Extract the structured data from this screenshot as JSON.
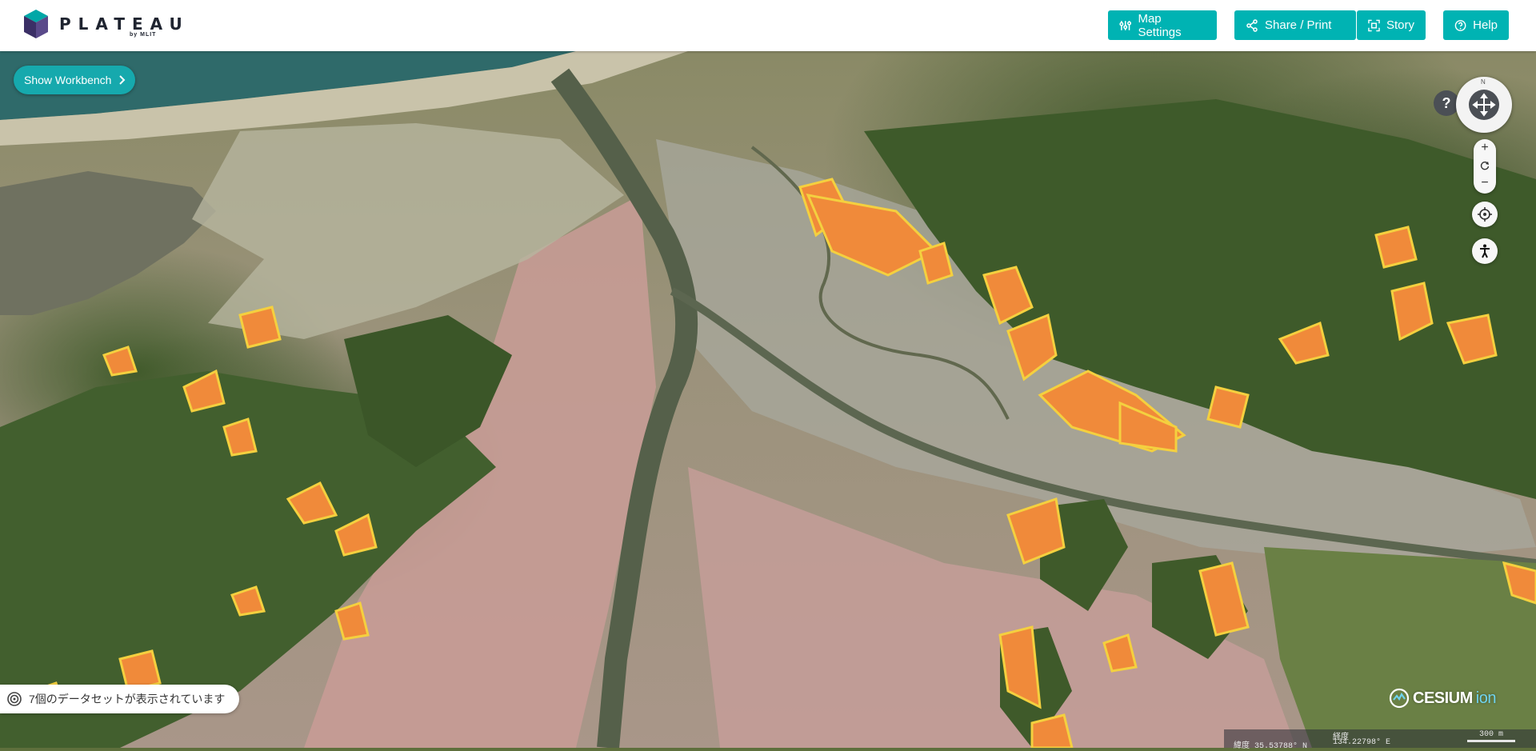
{
  "app": {
    "brand": "PLATEAU",
    "brand_sub": "by MLIT"
  },
  "toolbar": {
    "map_settings": "Map Settings",
    "share_print": "Share / Print",
    "story": "Story",
    "help": "Help"
  },
  "workbench": {
    "label": "Show Workbench"
  },
  "navigation": {
    "north": "N",
    "help": "?",
    "zoom_in": "+",
    "zoom_out": "−"
  },
  "status": {
    "datasets": "7個のデータセットが表示されています"
  },
  "attribution": {
    "cesium": "CESIUM",
    "ion": "ion"
  },
  "coords": {
    "latitude": "緯度  35.53788° N",
    "longitude_label": "経度",
    "longitude": "134.22798° E",
    "scale": "300 m"
  },
  "colors": {
    "accent": "#00b3b3",
    "workbench": "#16a9ad",
    "hazard_orange": "#f08a3a",
    "hazard_yellow": "#f4d03f",
    "flood_pink": "#d98f97"
  }
}
